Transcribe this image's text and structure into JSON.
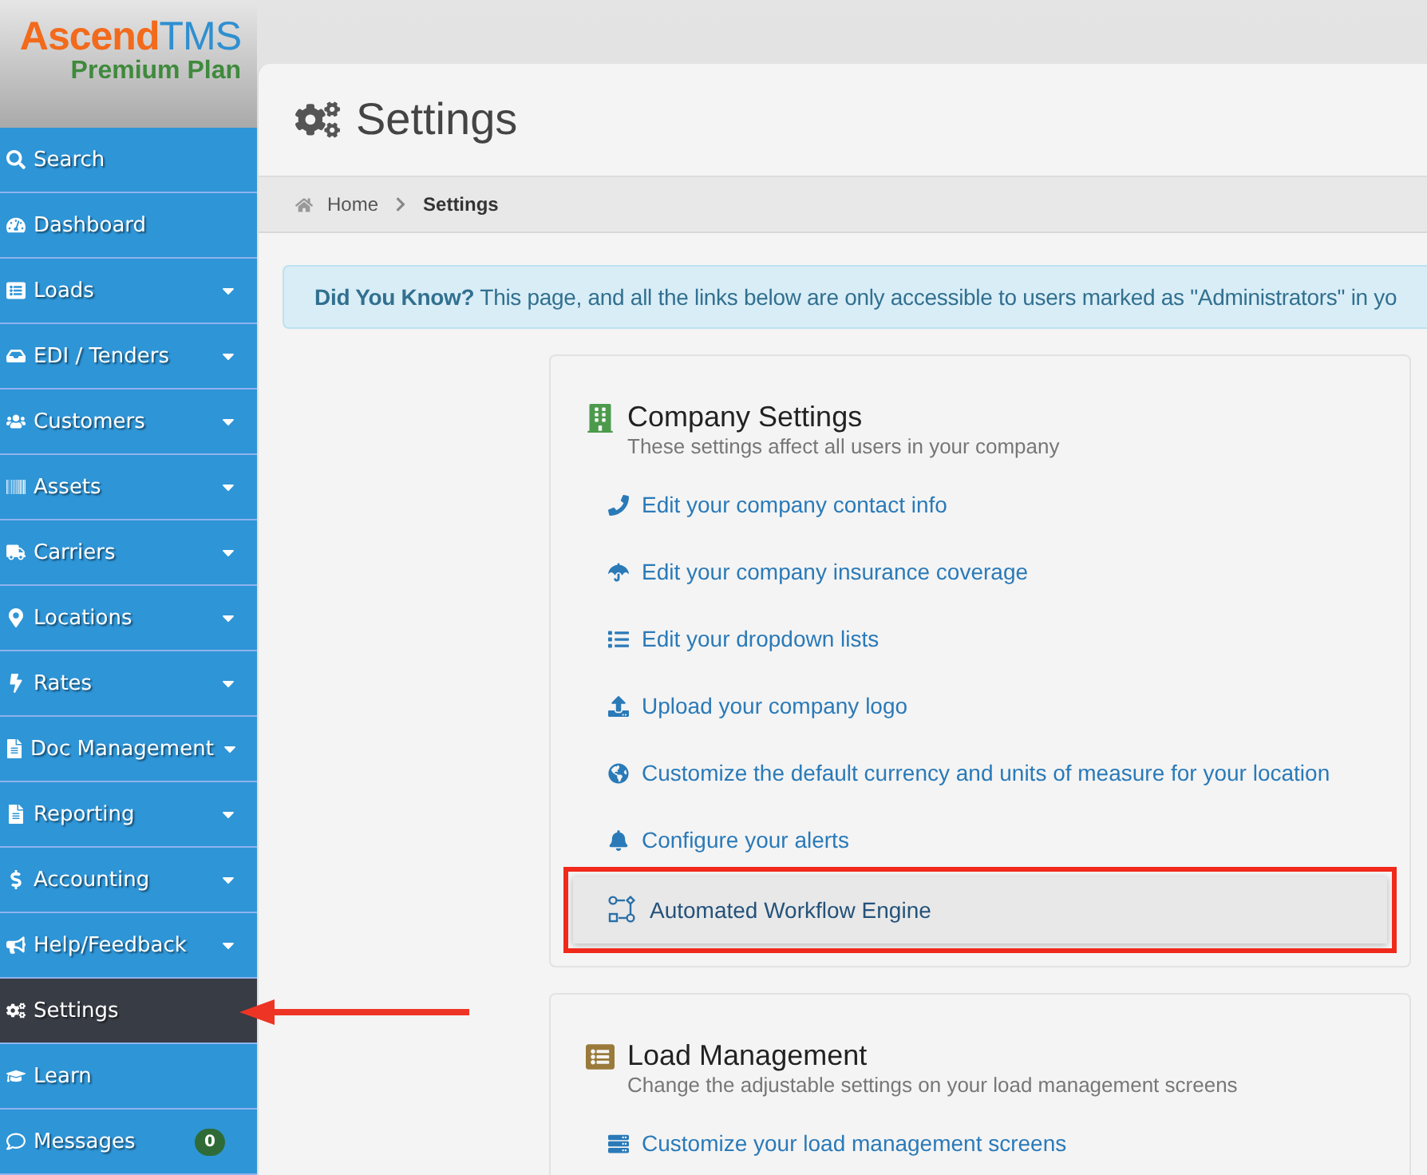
{
  "logo": {
    "name_part1": "Ascend",
    "name_part2": "TMS",
    "plan": "Premium Plan"
  },
  "sidebar": {
    "items": [
      {
        "label": "Search",
        "has_submenu": false,
        "selected": false
      },
      {
        "label": "Dashboard",
        "has_submenu": false,
        "selected": false
      },
      {
        "label": "Loads",
        "has_submenu": true,
        "selected": false
      },
      {
        "label": "EDI / Tenders",
        "has_submenu": true,
        "selected": false
      },
      {
        "label": "Customers",
        "has_submenu": true,
        "selected": false
      },
      {
        "label": "Assets",
        "has_submenu": true,
        "selected": false
      },
      {
        "label": "Carriers",
        "has_submenu": true,
        "selected": false
      },
      {
        "label": "Locations",
        "has_submenu": true,
        "selected": false
      },
      {
        "label": "Rates",
        "has_submenu": true,
        "selected": false
      },
      {
        "label": "Doc Management",
        "has_submenu": true,
        "selected": false
      },
      {
        "label": "Reporting",
        "has_submenu": true,
        "selected": false
      },
      {
        "label": "Accounting",
        "has_submenu": true,
        "selected": false
      },
      {
        "label": "Help/Feedback",
        "has_submenu": true,
        "selected": false
      },
      {
        "label": "Settings",
        "has_submenu": false,
        "selected": true,
        "pointed_at": true
      },
      {
        "label": "Learn",
        "has_submenu": false,
        "selected": false
      },
      {
        "label": "Messages",
        "has_submenu": false,
        "selected": false,
        "badge": "0"
      }
    ]
  },
  "page_title": "Settings",
  "breadcrumb": [
    {
      "label": "Home",
      "current": false
    },
    {
      "label": "Settings",
      "current": true
    }
  ],
  "info_box": "**Did You Know?** This page, and all the links below are only accessible to users marked as \"Administrators\" in yo",
  "sections": [
    {
      "title": "Company Settings",
      "subtitle": "These settings affect all users in your company",
      "links": [
        {
          "label": "Edit your company contact info",
          "highlighted": false
        },
        {
          "label": "Edit your company insurance coverage",
          "highlighted": false
        },
        {
          "label": "Edit your dropdown lists",
          "highlighted": false
        },
        {
          "label": "Upload your company logo",
          "highlighted": false
        },
        {
          "label": "Customize the default currency and units of measure for your location",
          "highlighted": false
        },
        {
          "label": "Configure your alerts",
          "highlighted": false
        },
        {
          "label": "Automated Workflow Engine",
          "highlighted": true
        }
      ]
    },
    {
      "title": "Load Management",
      "subtitle": "Change the adjustable settings on your load management screens",
      "links": [
        {
          "label": "Customize your load management screens",
          "highlighted": false
        }
      ]
    }
  ]
}
